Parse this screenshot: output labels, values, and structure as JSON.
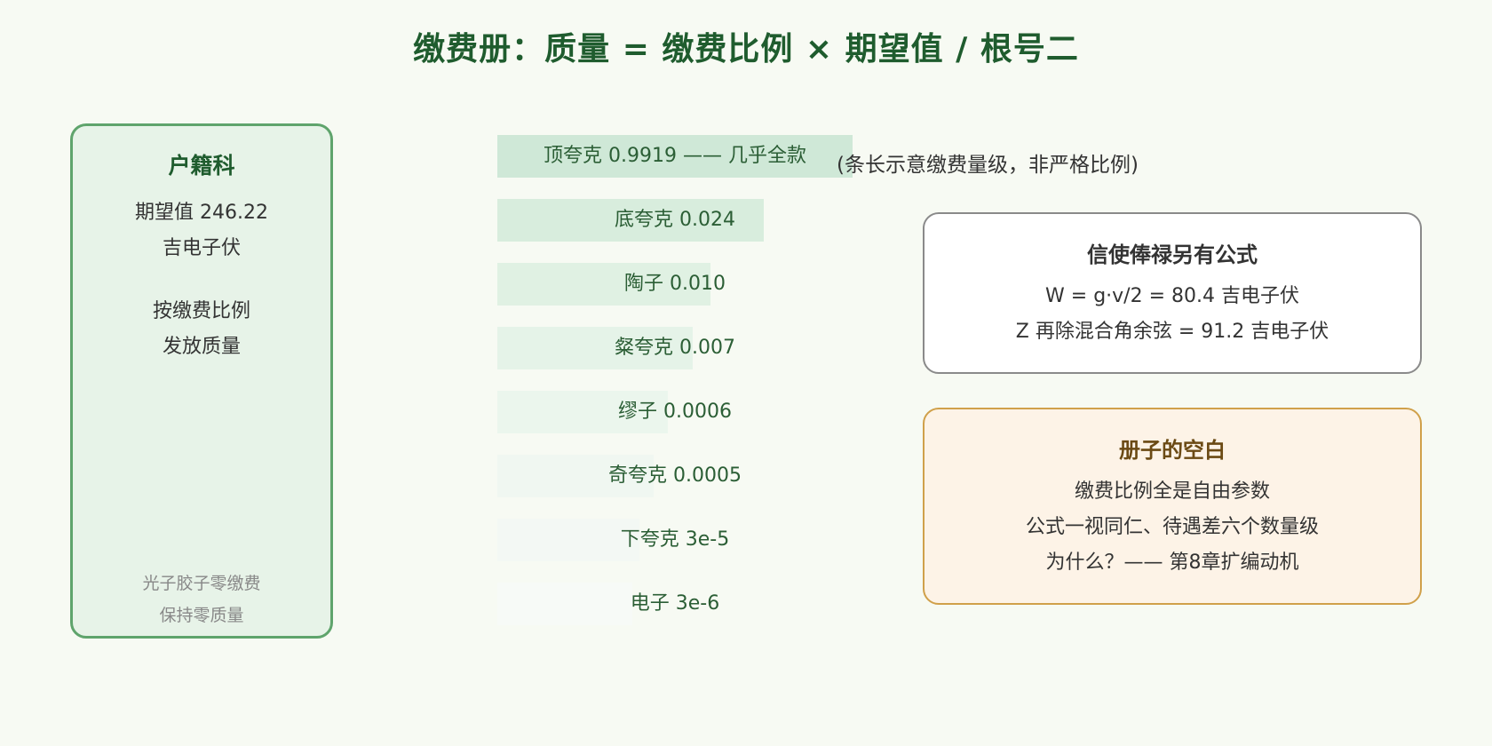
{
  "title": "缴费册：质量 = 缴费比例 × 期望值 / 根号二",
  "left_panel": {
    "title": "户籍科",
    "lines": [
      "期望值 246.22",
      "吉电子伏",
      "按缴费比例",
      "发放质量"
    ],
    "notes": [
      "光子胶子零缴费",
      "保持零质量"
    ]
  },
  "bars_note": "(条长示意缴费量级，非严格比例)",
  "chart_data": {
    "type": "bar",
    "orientation": "horizontal",
    "scale": "schematic",
    "categories": [
      "顶夸克",
      "底夸克",
      "陶子",
      "粲夸克",
      "缪子",
      "奇夸克",
      "下夸克",
      "电子"
    ],
    "values": [
      0.9919,
      0.024,
      0.01,
      0.007,
      0.0006,
      0.0005,
      3e-05,
      3e-06
    ],
    "labels": [
      "顶夸克 0.9919 —— 几乎全款",
      "底夸克 0.024",
      "陶子 0.010",
      "粲夸克 0.007",
      "缪子 0.0006",
      "奇夸克 0.0005",
      "下夸克 3e-5",
      "电子 3e-6"
    ],
    "relative_length": [
      1.0,
      0.75,
      0.6,
      0.55,
      0.48,
      0.44,
      0.4,
      0.38
    ],
    "colors": [
      "#cfe8d7",
      "#d8eddd",
      "#e0f1e3",
      "#e5f3e8",
      "#ebf6ed",
      "#f0f7f1",
      "#f3f8f4",
      "#f7faf7"
    ]
  },
  "w_box": {
    "title": "信使俸禄另有公式",
    "lines": [
      "W = g·v/2 = 80.4 吉电子伏",
      "Z 再除混合角余弦 = 91.2 吉电子伏"
    ]
  },
  "blank_box": {
    "title": "册子的空白",
    "lines": [
      "缴费比例全是自由参数",
      "公式一视同仁、待遇差六个数量级",
      "为什么？—— 第8章扩编动机"
    ]
  },
  "colors": {
    "background": "#f7faf3",
    "title": "#1f5c2e",
    "panel_border": "#5fa46c",
    "panel_fill": "#e7f3e8",
    "w_box_border": "#8a8a8a",
    "blank_box_border": "#d0a04a",
    "blank_box_fill": "#fdf3e7",
    "blank_box_title": "#6b4a14"
  }
}
